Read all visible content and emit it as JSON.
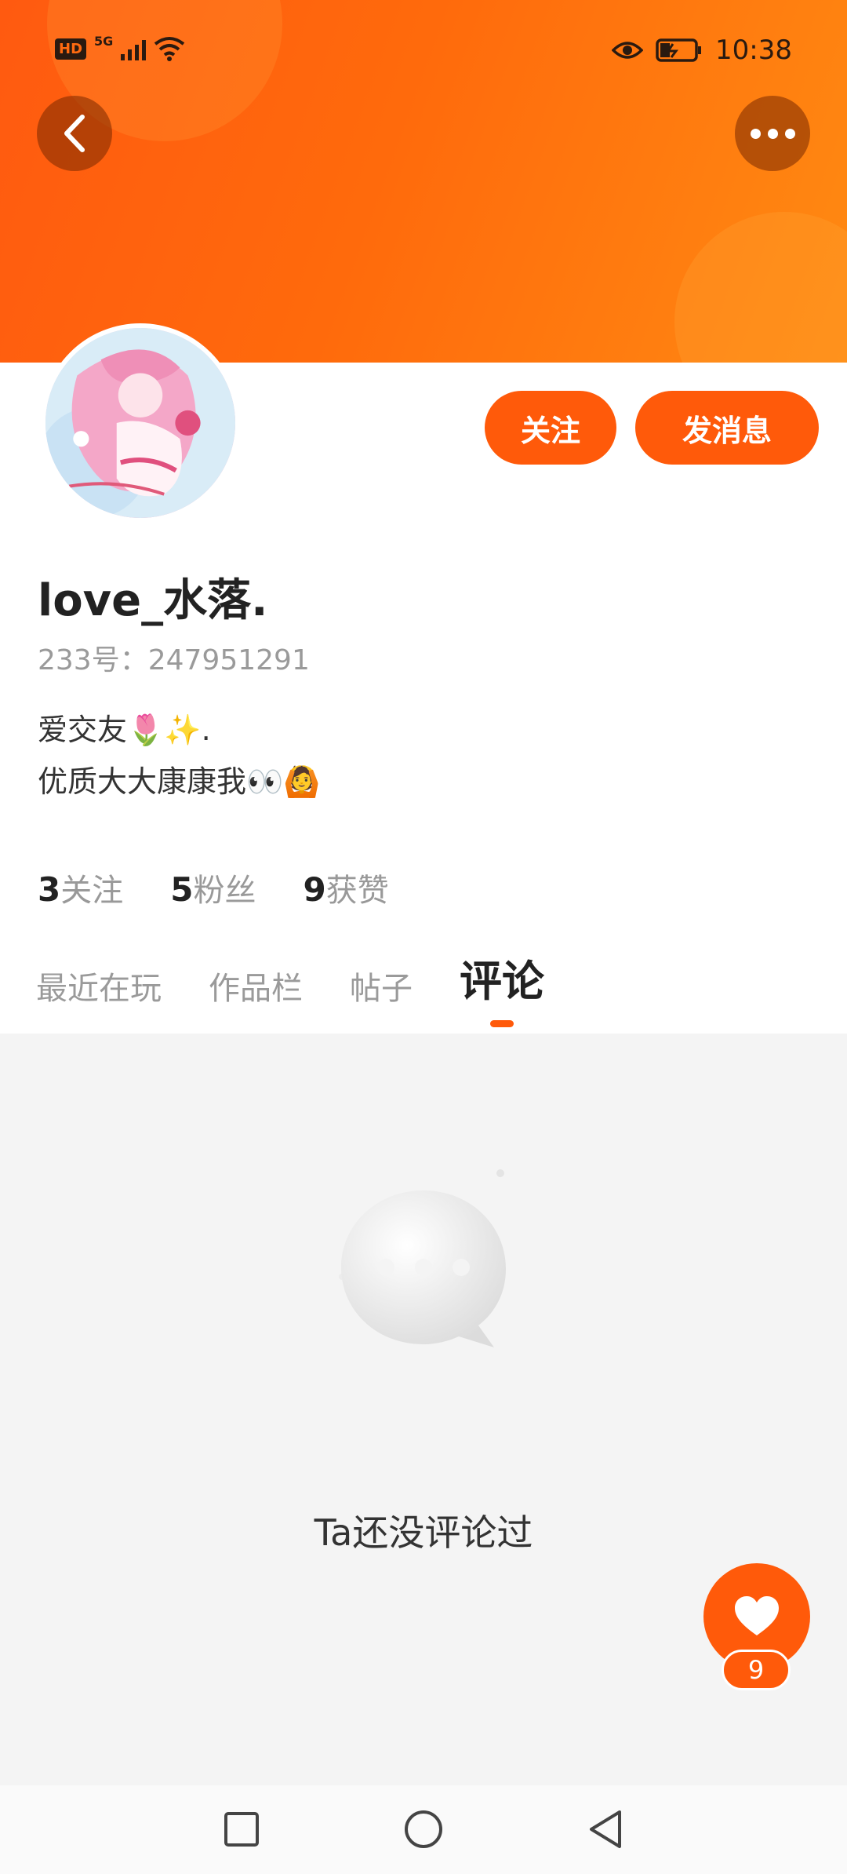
{
  "status_bar": {
    "network_hd": "HD",
    "network_type": "5G",
    "time": "10:38"
  },
  "header": {
    "back_icon": "chevron-left-icon",
    "more_icon": "more-horizontal-icon"
  },
  "profile": {
    "avatar_alt": "avatar-illustration",
    "follow_label": "关注",
    "message_label": "发消息",
    "username": "love_水落.",
    "account_id": "233号：247951291",
    "bio_lines": [
      "爱交友🌷✨.",
      "优质大大康康我👀🙆"
    ]
  },
  "stats": [
    {
      "value": "3",
      "label": "关注"
    },
    {
      "value": "5",
      "label": "粉丝"
    },
    {
      "value": "9",
      "label": "获赞"
    }
  ],
  "tabs": [
    {
      "label": "最近在玩",
      "active": false
    },
    {
      "label": "作品栏",
      "active": false
    },
    {
      "label": "帖子",
      "active": false
    },
    {
      "label": "评论",
      "active": true
    }
  ],
  "empty_state": {
    "illustration_icon": "chat-bubble-icon",
    "message": "Ta还没评论过"
  },
  "like_button": {
    "icon": "heart-icon",
    "count": "9"
  },
  "colors": {
    "accent": "#ff5a0a",
    "banner_start": "#ff5a10",
    "banner_end": "#ff8a12"
  }
}
